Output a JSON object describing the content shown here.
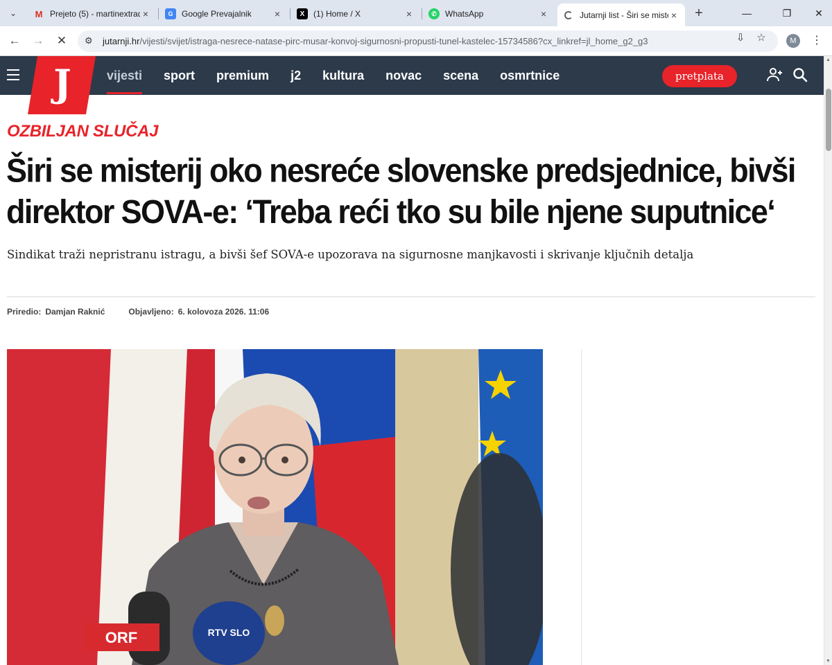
{
  "browser": {
    "tabs": [
      {
        "label": "Prejeto (5) - martinextrad",
        "icon": "gmail-icon",
        "active": false
      },
      {
        "label": "Google Prevajalnik",
        "icon": "google-translate-icon",
        "active": false
      },
      {
        "label": "(1) Home / X",
        "icon": "x-icon",
        "active": false
      },
      {
        "label": "WhatsApp",
        "icon": "whatsapp-icon",
        "active": false
      },
      {
        "label": "Jutarnji list - Širi se miste",
        "icon": "loading-icon",
        "active": true
      }
    ],
    "url_domain": "jutarnji.hr",
    "url_path": "/vijesti/svijet/istraga-nesrece-natase-pirc-musar-konvoj-sigurnosni-propusti-tunel-kastelec-15734586?cx_linkref=jl_home_g2_g3",
    "profile_initial": "M"
  },
  "site": {
    "logo_letter": "J",
    "nav": [
      "vijesti",
      "sport",
      "premium",
      "j2",
      "kultura",
      "novac",
      "scena",
      "osmrtnice"
    ],
    "active_nav": "vijesti",
    "subscribe_label": "pretplata"
  },
  "article": {
    "kicker": "OZBILJAN SLUČAJ",
    "headline": "Širi se misterij oko nesreće slovenske predsjednice, bivši direktor SOVA-e: ‘Treba reći tko su bile njene suputnice‘",
    "lead": "Sindikat traži nepristranu istragu, a bivši šef SOVA-e upozorava na sigurnosne manjkavosti i skrivanje ključnih detalja",
    "author_label": "Priredio:",
    "author": "Damjan Raknić",
    "published_label": "Objavljeno:",
    "published": "6. kolovoza 2026. 11:06",
    "photo_mic_labels": [
      "ORF",
      "RTV SLO"
    ]
  },
  "colors": {
    "brand_red": "#e8232a",
    "nav_bg": "#2c3a4a",
    "tabstrip_bg": "#dfe5ef"
  }
}
